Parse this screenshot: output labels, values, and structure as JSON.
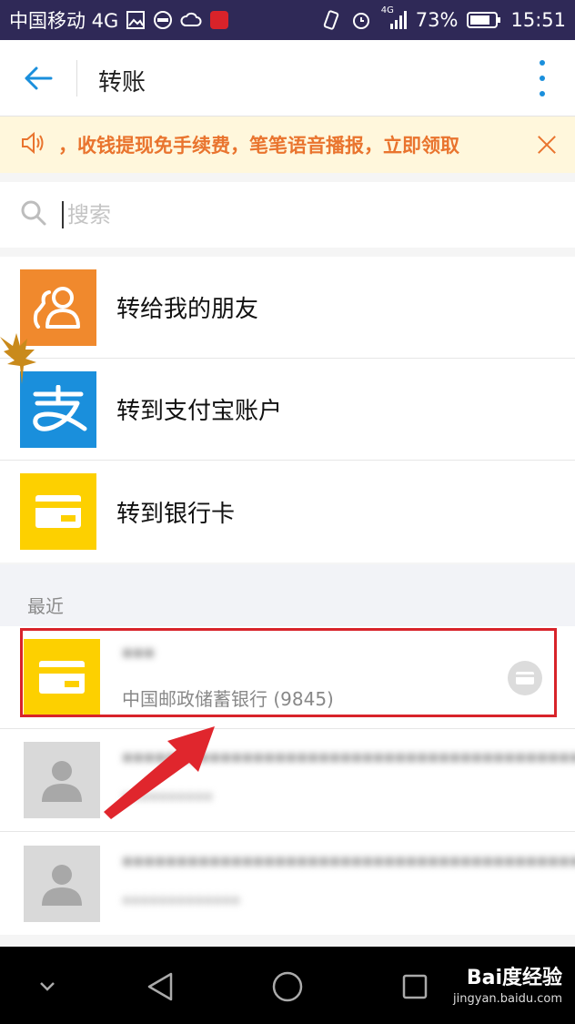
{
  "status_bar": {
    "carrier": "中国移动 4G",
    "network_small": "4G",
    "battery": "73%",
    "time": "15:51"
  },
  "header": {
    "title": "转账"
  },
  "notice": {
    "text": "，收钱提现免手续费，笔笔语音播报，立即领取"
  },
  "search": {
    "placeholder": "搜索"
  },
  "options": [
    {
      "label": "转给我的朋友",
      "icon": "friends-icon",
      "color": "#f0892d"
    },
    {
      "label": "转到支付宝账户",
      "icon": "alipay-icon",
      "color": "#1a8fdc"
    },
    {
      "label": "转到银行卡",
      "icon": "bank-card-icon",
      "color": "#fdd000"
    }
  ],
  "recent": {
    "header": "最近",
    "items": [
      {
        "name": "***",
        "sub": "中国邮政储蓄银行 (9845)",
        "icon": "bank-card-icon"
      },
      {
        "name": "********************************************",
        "sub": "**********",
        "icon": "avatar-icon"
      },
      {
        "name": "********************************************",
        "sub": "*************",
        "icon": "avatar-icon"
      }
    ]
  },
  "watermark": {
    "main": "Bai度经验",
    "sub": "jingyan.baidu.com"
  },
  "colors": {
    "status_bar": "#2f2957",
    "accent_blue": "#1a8fdc",
    "notice_orange": "#e9742e",
    "highlight_red": "#d8232a"
  }
}
